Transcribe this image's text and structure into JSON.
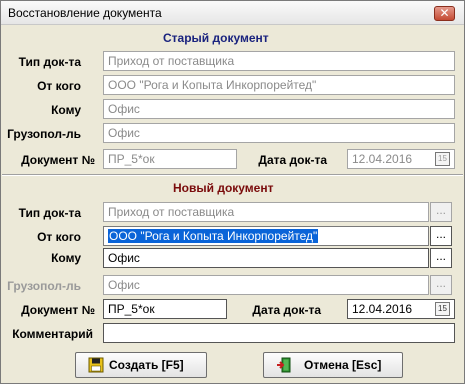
{
  "window": {
    "title": "Восстановление документа",
    "close_label": "✕"
  },
  "old_doc": {
    "heading": "Старый документ",
    "type_label": "Тип док-та",
    "type_value": "Приход от поставщика",
    "from_label": "От кого",
    "from_value": "ООО \"Рога и Копыта Инкорпорейтед\"",
    "to_label": "Кому",
    "to_value": "Офис",
    "consignee_label": "Грузопол-ль",
    "consignee_value": "Офис",
    "docnum_label": "Документ №",
    "docnum_value": "ПР_5*ок",
    "date_label": "Дата док-та",
    "date_value": "12.04.2016",
    "calendar_icon_text": "15"
  },
  "new_doc": {
    "heading": "Новый документ",
    "type_label": "Тип док-та",
    "type_value": "Приход от поставщика",
    "from_label": "От кого",
    "from_value": "ООО \"Рога и Копыта Инкорпорейтед\"",
    "to_label": "Кому",
    "to_value": "Офис",
    "consignee_label": "Грузопол-ль",
    "consignee_value": "Офис",
    "docnum_label": "Документ №",
    "docnum_value": "ПР_5*ок",
    "date_label": "Дата док-та",
    "date_value": "12.04.2016",
    "calendar_icon_text": "15",
    "comment_label": "Комментарий",
    "comment_value": ""
  },
  "lookup_label": "...",
  "buttons": {
    "create_label": "Создать [F5]",
    "cancel_label": "Отмена [Esc]"
  },
  "colors": {
    "old_heading": "#1a237e",
    "new_heading": "#7a0b0b",
    "selection": "#0a64d8"
  }
}
